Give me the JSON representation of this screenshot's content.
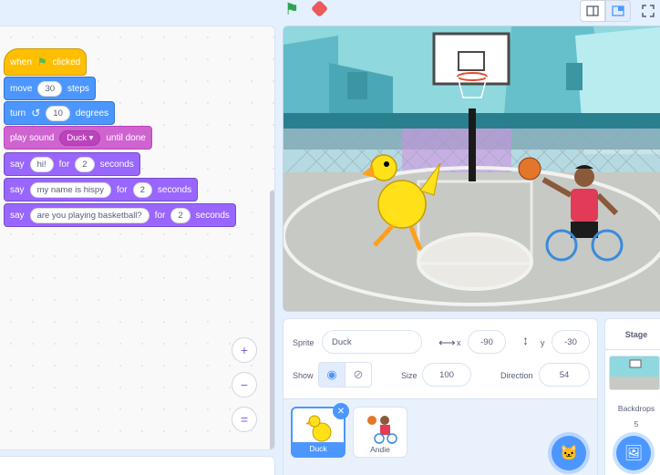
{
  "blocks": {
    "when_flag": {
      "when": "when",
      "clicked": "clicked"
    },
    "move": {
      "label": "move",
      "value": "30",
      "suffix": "steps"
    },
    "turn": {
      "label": "turn",
      "value": "10",
      "suffix": "degrees"
    },
    "play_sound": {
      "label": "play sound",
      "value": "Duck",
      "suffix": "until done"
    },
    "say1": {
      "label": "say",
      "msg": "hi!",
      "for": "for",
      "secs": "2",
      "suffix": "seconds"
    },
    "say2": {
      "label": "say",
      "msg": "my name is hispy",
      "for": "for",
      "secs": "2",
      "suffix": "seconds"
    },
    "say3": {
      "label": "say",
      "msg": "are you playing basketball?",
      "for": "for",
      "secs": "2",
      "suffix": "seconds"
    }
  },
  "zoom": {
    "in": "+",
    "out": "−",
    "reset": "="
  },
  "sprite_info": {
    "sprite_label": "Sprite",
    "sprite_name": "Duck",
    "x_label": "x",
    "x_value": "-90",
    "y_label": "y",
    "y_value": "-30",
    "show_label": "Show",
    "size_label": "Size",
    "size_value": "100",
    "direction_label": "Direction",
    "direction_value": "54"
  },
  "sprites": [
    {
      "name": "Duck",
      "selected": true
    },
    {
      "name": "Andie",
      "selected": false
    }
  ],
  "stage_panel": {
    "title": "Stage",
    "backdrops_label": "Backdrops",
    "backdrops_count": "5"
  },
  "colors": {
    "events": "#ffbf00",
    "motion": "#4c97ff",
    "sound": "#cf63cf",
    "looks": "#9966ff",
    "accent": "#855cd6"
  }
}
